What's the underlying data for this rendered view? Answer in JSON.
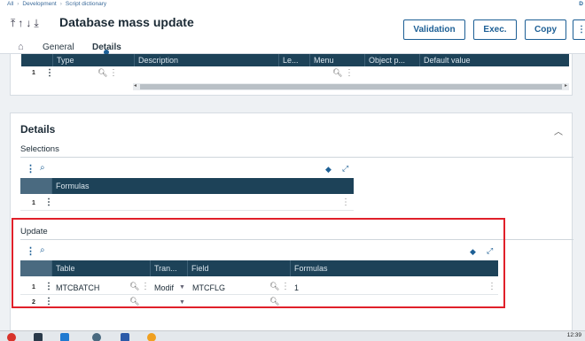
{
  "breadcrumb": {
    "items": [
      "All",
      "Development",
      "Script dictionary"
    ],
    "right": "D"
  },
  "header": {
    "title": "Database mass update",
    "buttons": {
      "validation": "Validation",
      "exec": "Exec.",
      "copy": "Copy"
    },
    "tabs": {
      "general": "General",
      "details": "Details"
    }
  },
  "top_grid": {
    "columns": [
      "Type",
      "Description",
      "Le...",
      "Menu",
      "Object p...",
      "Default value"
    ],
    "rows": [
      {
        "num": "1"
      }
    ]
  },
  "details": {
    "title": "Details",
    "selections": {
      "title": "Selections",
      "columns": [
        "Formulas"
      ],
      "rows": [
        {
          "num": "1"
        }
      ]
    },
    "update": {
      "title": "Update",
      "columns": [
        "Table",
        "Tran...",
        "Field",
        "Formulas"
      ],
      "rows": [
        {
          "num": "1",
          "table": "MTCBATCH",
          "trans": "Modif",
          "field": "MTCFLG",
          "formula": "1"
        },
        {
          "num": "2",
          "table": "",
          "trans": "",
          "field": "",
          "formula": ""
        }
      ]
    }
  },
  "taskbar": {
    "time": "12:39"
  },
  "colors": {
    "accent": "#1d5f95",
    "grid_header": "#1d4258",
    "highlight": "#e0202a"
  }
}
